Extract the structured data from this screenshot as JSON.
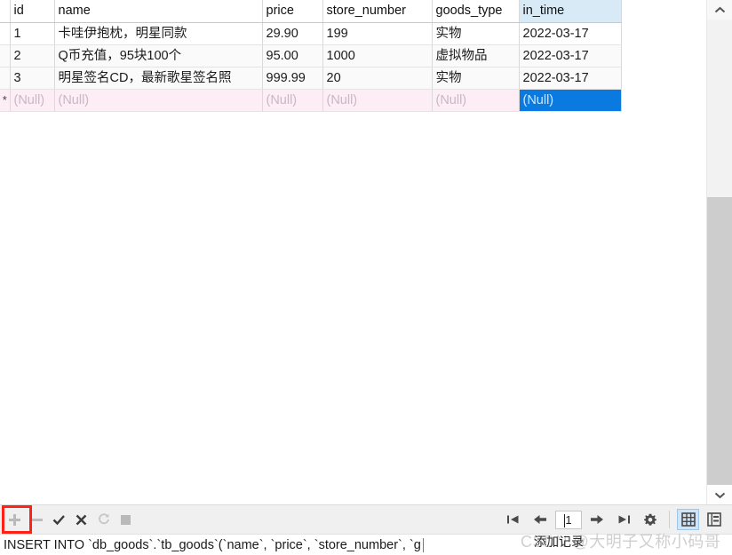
{
  "grid": {
    "columns": [
      {
        "key": "marker",
        "label": ""
      },
      {
        "key": "id",
        "label": "id"
      },
      {
        "key": "name",
        "label": "name"
      },
      {
        "key": "price",
        "label": "price"
      },
      {
        "key": "store_number",
        "label": "store_number"
      },
      {
        "key": "goods_type",
        "label": "goods_type"
      },
      {
        "key": "in_time",
        "label": "in_time"
      }
    ],
    "selected_column": "in_time",
    "rows": [
      {
        "marker": "",
        "id": "1",
        "name": "卡哇伊抱枕，明星同款",
        "price": "29.90",
        "store_number": "199",
        "goods_type": "实物",
        "in_time": "2022-03-17"
      },
      {
        "marker": "",
        "id": "2",
        "name": "Q币充值，95块100个",
        "price": "95.00",
        "store_number": "1000",
        "goods_type": "虚拟物品",
        "in_time": "2022-03-17"
      },
      {
        "marker": "",
        "id": "3",
        "name": "明星签名CD，最新歌星签名照",
        "price": "999.99",
        "store_number": "20",
        "goods_type": "实物",
        "in_time": "2022-03-17"
      }
    ],
    "new_row": {
      "marker": "*",
      "id": "(Null)",
      "name": "(Null)",
      "price": "(Null)",
      "store_number": "(Null)",
      "goods_type": "(Null)",
      "in_time": "(Null)"
    },
    "colors": {
      "selected_cell_bg": "#0a7ae0",
      "selected_header_bg": "#d9eaf7",
      "new_row_bg": "#fdeef6",
      "null_text": "#c9b7c4"
    }
  },
  "toolbar": {
    "add_record_label": "+",
    "delete_record_label": "-",
    "apply_label": "✔",
    "cancel_label": "✖",
    "refresh_label": "⟳",
    "stop_label": "■",
    "first_page_label": "|←",
    "prev_page_label": "←",
    "page_value": "1",
    "next_page_label": "→",
    "last_page_label": "→|",
    "settings_label": "⚙",
    "grid_view_label": "grid-view",
    "form_view_label": "form-view"
  },
  "statusbar": {
    "sql": "INSERT INTO `db_goods`.`tb_goods`(`name`, `price`, `store_number`, `g"
  },
  "tooltip": {
    "text": "添加记录"
  },
  "watermark": {
    "text": "CSDN @大明子又称小码哥"
  },
  "scrollbar": {
    "up_arrow": "⌃",
    "down_arrow": "⌄"
  }
}
